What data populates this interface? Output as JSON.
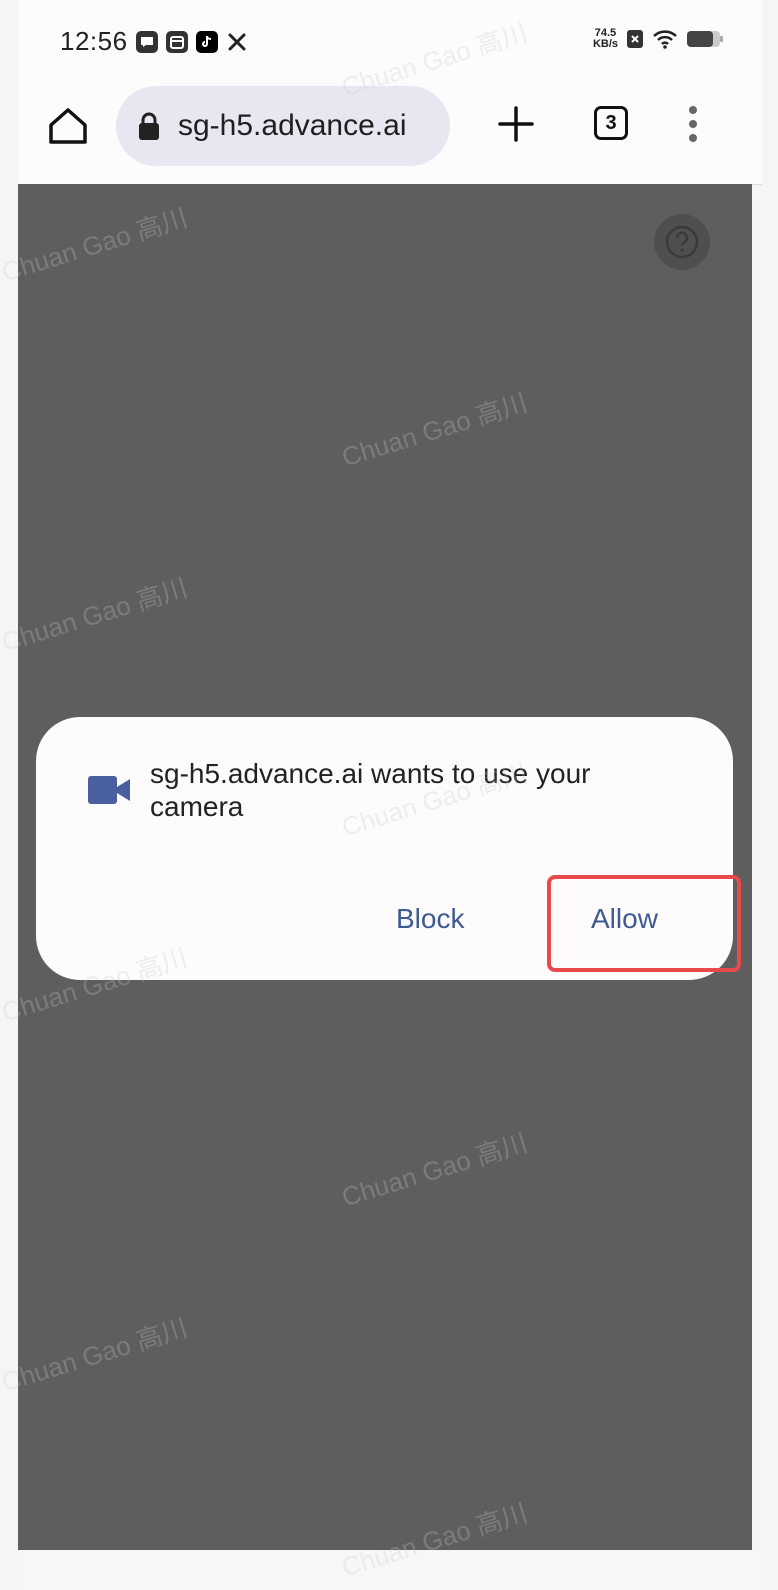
{
  "status_bar": {
    "time": "12:56",
    "net_speed_value": "74.5",
    "net_speed_unit": "KB/s",
    "icons": [
      "message-icon",
      "calendar-icon",
      "tiktok-icon",
      "tools-icon"
    ],
    "right_icons": [
      "sim-off-icon",
      "wifi-icon",
      "battery-icon"
    ]
  },
  "browser": {
    "url": "sg-h5.advance.ai",
    "tab_count": "3"
  },
  "dialog": {
    "message": "sg-h5.advance.ai wants to use your camera",
    "block_label": "Block",
    "allow_label": "Allow"
  },
  "watermark": "Chuan Gao 高川",
  "colors": {
    "accent": "#3e5a92",
    "camera_icon": "#4a5fa0",
    "highlight": "#e84a4a",
    "overlay": "#5e5e5e"
  }
}
